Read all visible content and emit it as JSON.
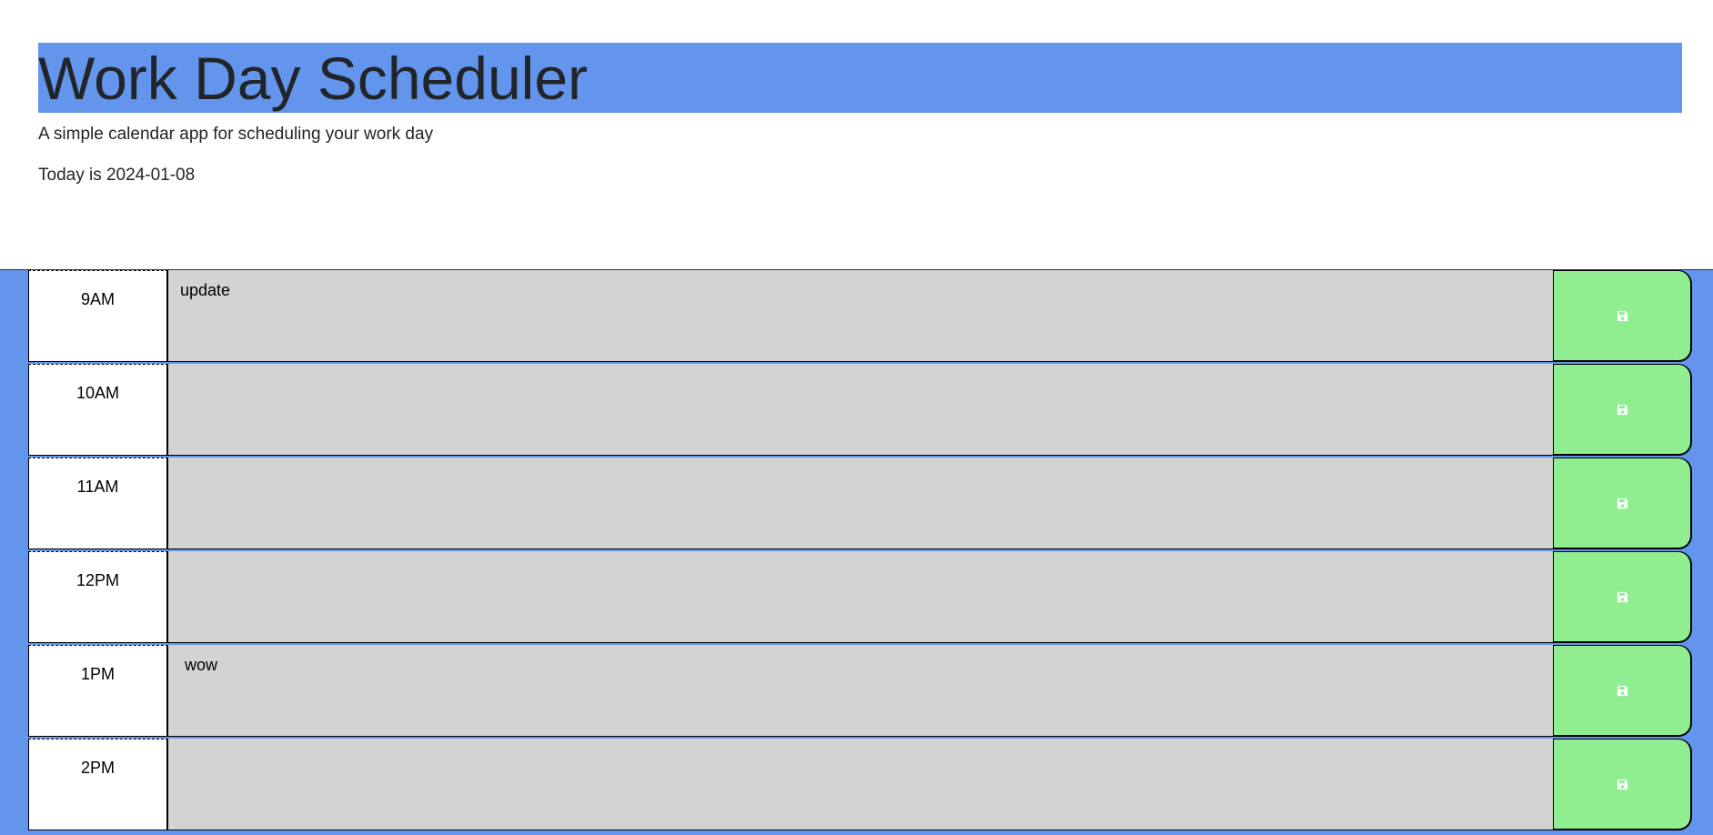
{
  "header": {
    "title": "Work Day Scheduler",
    "subtitle": "A simple calendar app for scheduling your work day",
    "today": "Today is 2024-01-08"
  },
  "colors": {
    "title_bar": "#6495ed",
    "schedule_bg": "#6495ed",
    "hour_bg": "#ffffff",
    "description_bg": "#d3d3d3",
    "save_button": "#90ee90",
    "save_icon": "#ffffff"
  },
  "save_icon": "floppy-disk-icon",
  "rows": [
    {
      "hour": "9AM",
      "text": "update"
    },
    {
      "hour": "10AM",
      "text": ""
    },
    {
      "hour": "11AM",
      "text": ""
    },
    {
      "hour": "12PM",
      "text": ""
    },
    {
      "hour": "1PM",
      "text": " wow"
    },
    {
      "hour": "2PM",
      "text": ""
    }
  ]
}
